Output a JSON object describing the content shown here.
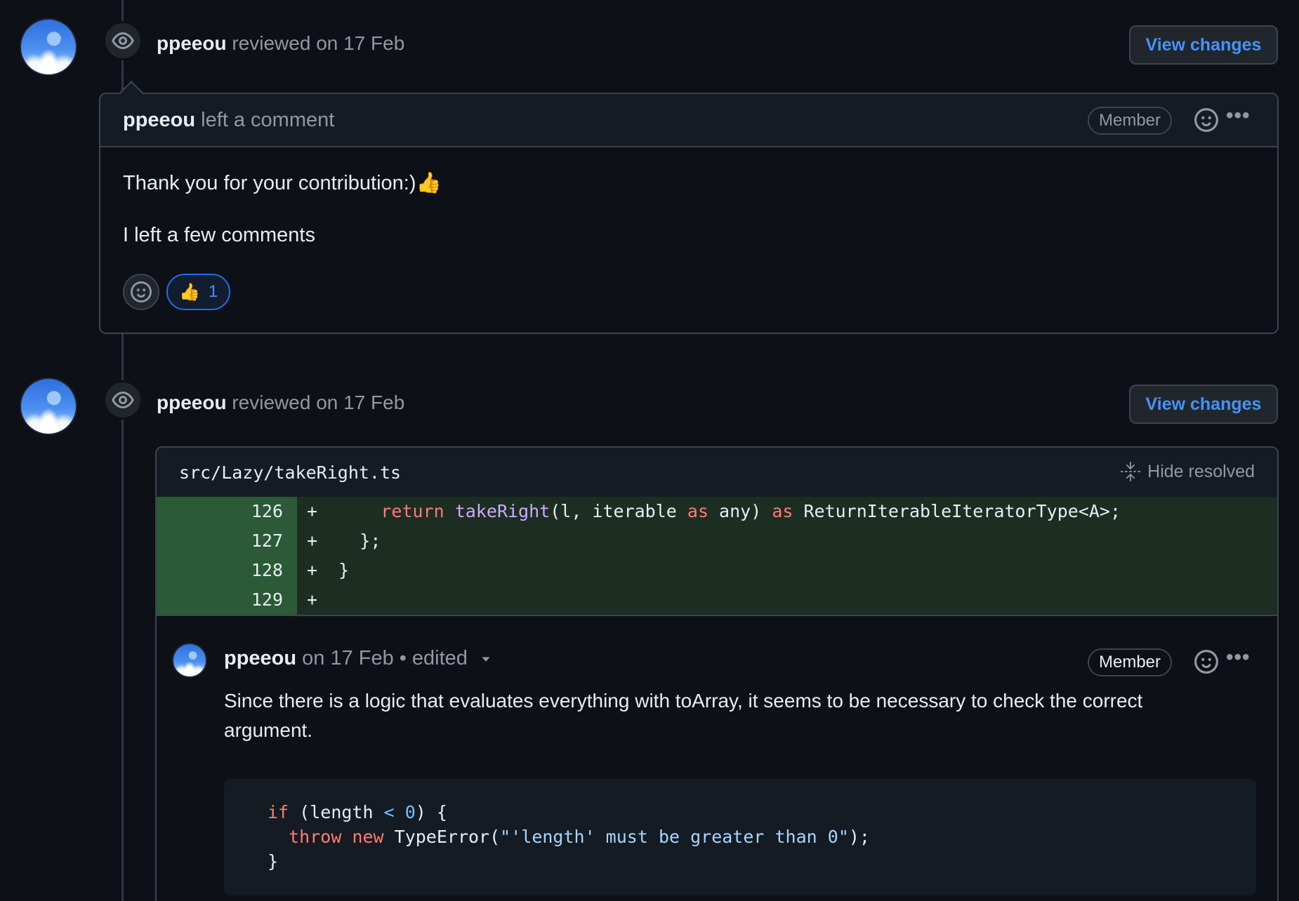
{
  "reviews": [
    {
      "author": "ppeeou",
      "action": "reviewed",
      "date": "on 17 Feb",
      "view_changes_label": "View changes",
      "comment": {
        "author": "ppeeou",
        "action": "left a comment",
        "badge": "Member",
        "body": [
          "Thank you for your contribution:)👍",
          "I left a few comments"
        ],
        "reactions": [
          {
            "emoji": "👍",
            "count": "1"
          }
        ]
      }
    },
    {
      "author": "ppeeou",
      "action": "reviewed",
      "date": "on 17 Feb",
      "view_changes_label": "View changes",
      "file": {
        "path": "src/Lazy/takeRight.ts",
        "hide_resolved_label": "Hide resolved",
        "diff_lines": [
          {
            "num": "126",
            "sign": "+"
          },
          {
            "num": "127",
            "sign": "+"
          },
          {
            "num": "128",
            "sign": "+"
          },
          {
            "num": "129",
            "sign": "+"
          }
        ]
      },
      "inline_comment": {
        "author": "ppeeou",
        "date": "on 17 Feb",
        "separator": "•",
        "edited": "edited",
        "badge": "Member",
        "body": "Since there is a logic that evaluates everything with toArray, it seems to be necessary to check the correct argument."
      }
    }
  ],
  "colors": {
    "background": "#0d1117",
    "accent": "#4493f8",
    "diff_added_bg": "#1b2e21",
    "diff_added_num_bg": "#2c5a36"
  },
  "icons": [
    "eye-icon",
    "smiley-icon",
    "kebab-icon",
    "thumbs-up-icon",
    "fold-icon",
    "triangle-down-icon"
  ]
}
